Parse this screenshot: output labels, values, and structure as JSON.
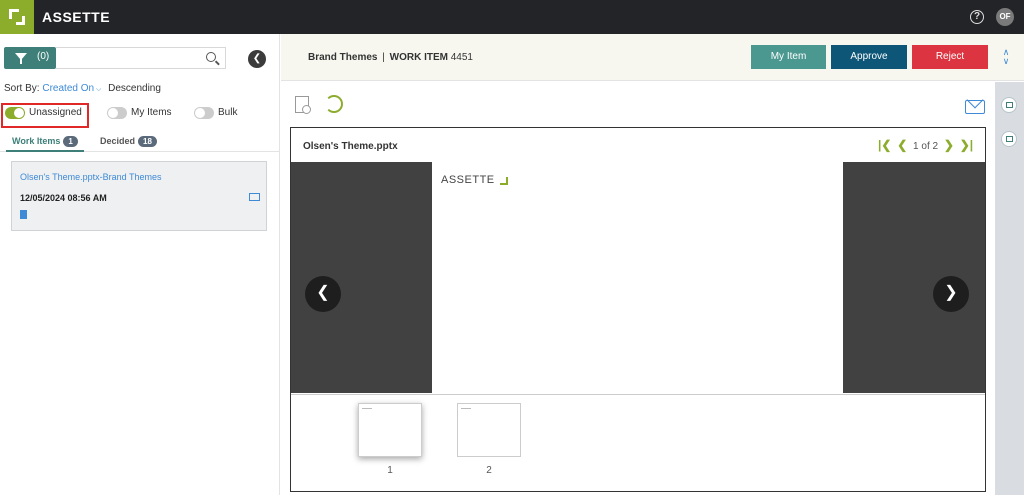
{
  "app": {
    "brand": "ASSETTE",
    "help_icon": "?",
    "avatar": "OF"
  },
  "left": {
    "filter_count": "(0)",
    "search_placeholder": "",
    "sort_prefix": "Sort By:",
    "sort_value": "Created On",
    "sort_order": "Descending",
    "toggles": [
      {
        "label": "Unassigned",
        "on": true
      },
      {
        "label": "My Items",
        "on": false
      },
      {
        "label": "Bulk",
        "on": false
      }
    ],
    "tabs": [
      {
        "label": "Work Items",
        "count": "1"
      },
      {
        "label": "Decided",
        "count": "18"
      }
    ],
    "card": {
      "title": "Olsen's Theme.pptx-Brand Themes",
      "date": "12/05/2024 08:56 AM"
    }
  },
  "header": {
    "category": "Brand Themes",
    "separator": "|",
    "work_item_label": "WORK ITEM",
    "work_item_id": "4451",
    "buttons": {
      "my_item": "My Item",
      "approve": "Approve",
      "reject": "Reject"
    }
  },
  "viewer": {
    "file_name": "Olsen's Theme.pptx",
    "page_label": "1 of 2",
    "slide_logo": "ASSETTE",
    "thumbnails": [
      "1",
      "2"
    ],
    "selected_page": 1,
    "total_pages": 2
  },
  "colors": {
    "accent_green": "#8cac2b",
    "teal": "#3e8079",
    "approve": "#0e5678",
    "reject": "#dc3440",
    "my_item": "#4a9890"
  }
}
